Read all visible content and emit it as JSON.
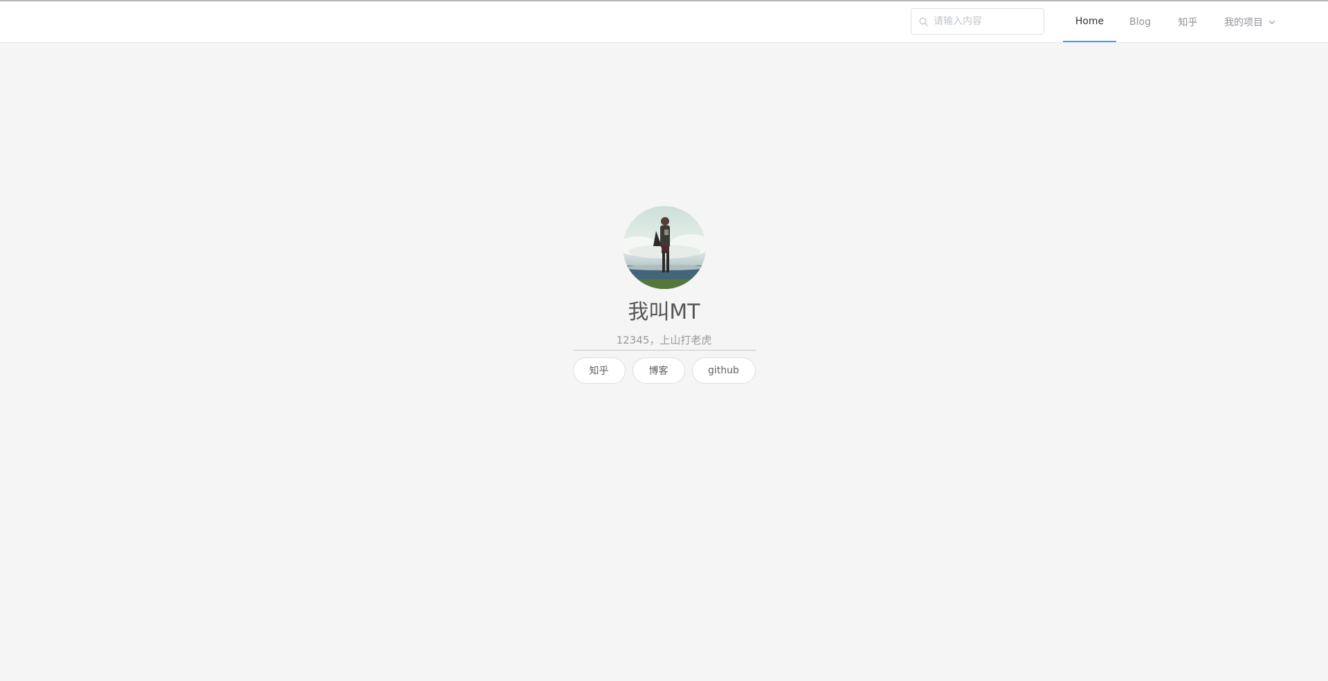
{
  "header": {
    "search": {
      "placeholder": "请输入内容",
      "value": ""
    },
    "nav": [
      {
        "label": "Home",
        "active": true
      },
      {
        "label": "Blog",
        "active": false
      },
      {
        "label": "知乎",
        "active": false
      },
      {
        "label": "我的项目",
        "active": false,
        "dropdown": true
      }
    ]
  },
  "profile": {
    "name": "我叫MT",
    "motto": "12345，上山打老虎",
    "links": [
      {
        "label": "知乎"
      },
      {
        "label": "博客"
      },
      {
        "label": "github"
      }
    ]
  },
  "colors": {
    "accent": "#409eff",
    "background": "#f5f5f5",
    "header_bg": "#ffffff"
  },
  "icons": {
    "search": "search-icon",
    "dropdown": "chevron-down-icon"
  }
}
